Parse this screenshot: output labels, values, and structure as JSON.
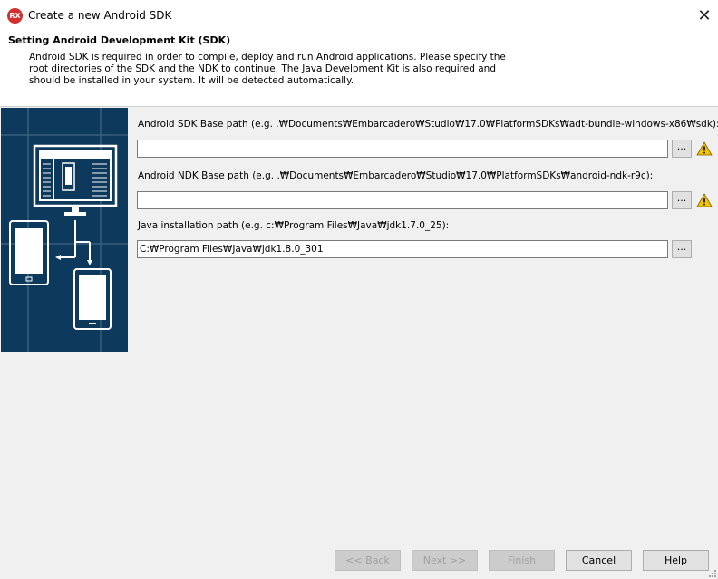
{
  "window": {
    "title": "Create a new Android SDK",
    "app_icon_text": "RX",
    "close_glyph": "✕"
  },
  "header": {
    "title": "Setting Android Development Kit (SDK)",
    "description": "Android SDK is required in order to compile, deploy and run Android applications. Please specify the root directories of the SDK and the NDK to continue. The Java Develpment Kit is also required and should be installed in your system. It will be detected automatically."
  },
  "fields": {
    "sdk": {
      "label": "Android SDK Base path (e.g. .₩Documents₩Embarcadero₩Studio₩17.0₩PlatformSDKs₩adt-bundle-windows-x86₩sdk):",
      "value": "",
      "browse_label": "...",
      "warning_icon": "warning-icon"
    },
    "ndk": {
      "label": "Android NDK Base path (e.g. .₩Documents₩Embarcadero₩Studio₩17.0₩PlatformSDKs₩android-ndk-r9c):",
      "value": "",
      "browse_label": "...",
      "warning_icon": "warning-icon"
    },
    "java": {
      "label": "Java installation path (e.g. c:₩Program Files₩Java₩jdk1.7.0_25):",
      "value": "C:₩Program Files₩Java₩jdk1.8.0_301",
      "browse_label": "..."
    }
  },
  "buttons": {
    "back": "<< Back",
    "next": "Next >>",
    "finish": "Finish",
    "cancel": "Cancel",
    "help": "Help"
  },
  "colors": {
    "side_panel": "#0d3a5c",
    "warning": "#f5c400",
    "disabled_text": "#a0a0a0"
  }
}
